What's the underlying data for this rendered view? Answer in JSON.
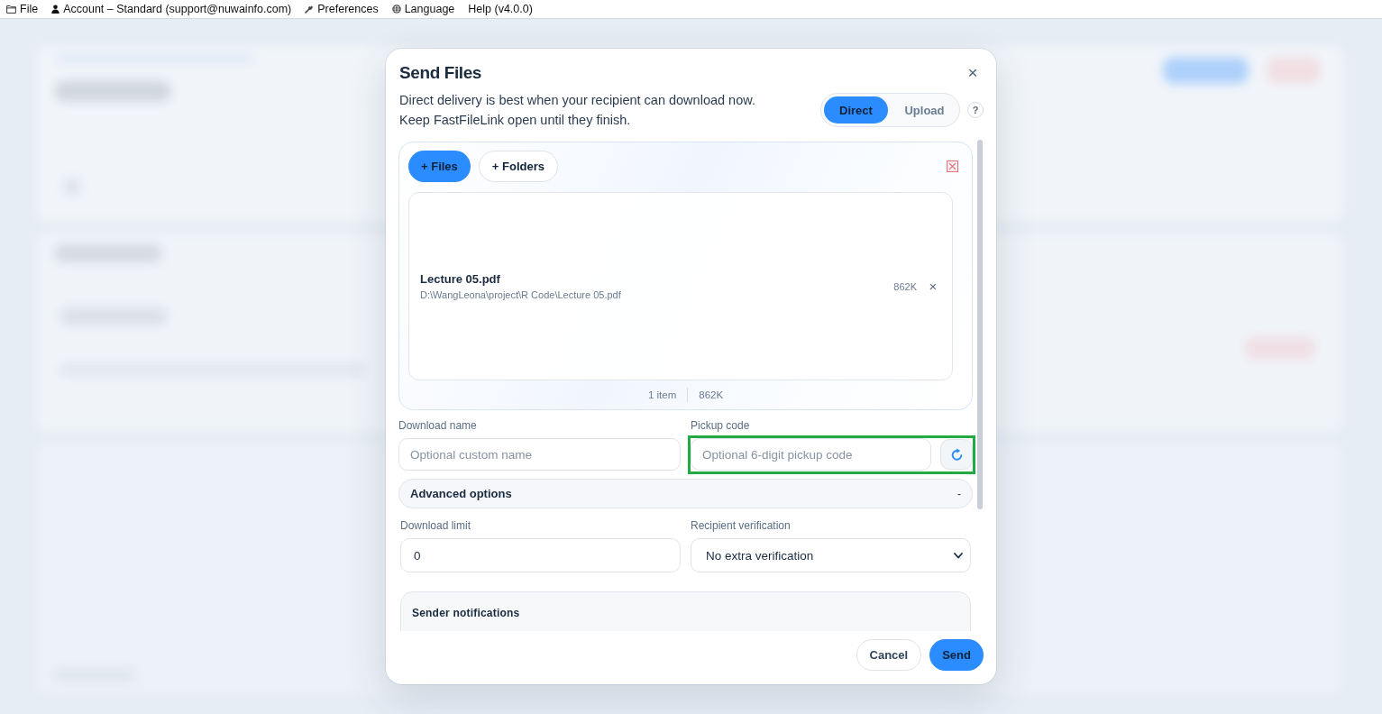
{
  "menu_bar": {
    "items": [
      {
        "label": "File"
      },
      {
        "label": "Account – Standard (support@nuwainfo.com)"
      },
      {
        "label": "Preferences"
      },
      {
        "label": "Language"
      },
      {
        "label": "Help (v4.0.0)"
      }
    ]
  },
  "dialog": {
    "title": "Send Files",
    "close": "×",
    "description": [
      "Direct delivery is best when your recipient can download now.",
      "Keep FastFileLink open until they finish."
    ],
    "delivery_modes": [
      {
        "label": "Direct",
        "selected": true
      },
      {
        "label": "Upload",
        "selected": false
      }
    ],
    "help": "?",
    "files_panel": {
      "buttons": [
        {
          "label": "+ Files",
          "kind": "primary"
        },
        {
          "label": "+ Folders",
          "kind": "secondary"
        }
      ],
      "files": [
        {
          "name": "Lecture 05.pdf",
          "path": "D:\\WangLeona\\project\\R Code\\Lecture 05.pdf",
          "size": "862K",
          "remove": "×"
        }
      ],
      "summary": {
        "count": "1 item",
        "total": "862K"
      }
    },
    "download_name": {
      "label": "Download name",
      "placeholder": "Optional custom name"
    },
    "pickup_code": {
      "label": "Pickup code",
      "placeholder": "Optional 6-digit pickup code",
      "highlighted": true
    },
    "advanced_options": {
      "label": "Advanced options",
      "toggle": "-",
      "expanded": true
    },
    "download_limit": {
      "label": "Download limit",
      "value": "0"
    },
    "recipient_verification": {
      "label": "Recipient verification",
      "value": "No extra verification"
    },
    "sender_notifications": {
      "title": "Sender notifications"
    },
    "footer_buttons": [
      {
        "label": "Cancel",
        "kind": "secondary"
      },
      {
        "label": "Send",
        "kind": "primary"
      }
    ]
  }
}
